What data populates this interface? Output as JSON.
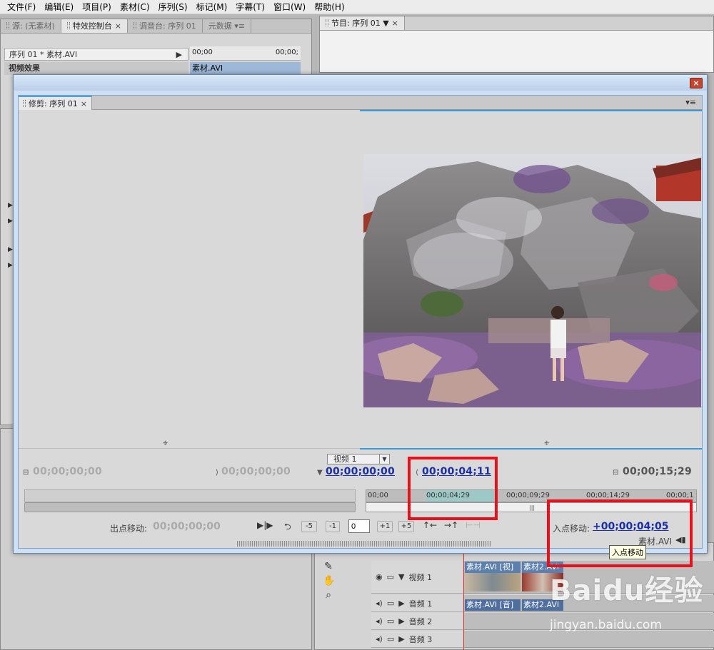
{
  "menubar": [
    "文件(F)",
    "编辑(E)",
    "项目(P)",
    "素材(C)",
    "序列(S)",
    "标记(M)",
    "字幕(T)",
    "窗口(W)",
    "帮助(H)"
  ],
  "left_panel": {
    "tabs": [
      "源: (无素材)",
      "特效控制台",
      "调音台: 序列 01",
      "元数据"
    ],
    "sequence_clip": "序列 01 * 素材.AVI",
    "ruler_start": "00;00",
    "ruler_end": "00;00;",
    "clip_label": "素材.AVI",
    "section": "视频效果"
  },
  "program_panel": {
    "tab": "节目: 序列 01"
  },
  "trim_window": {
    "tab": "修剪: 序列 01",
    "track_select": "视频 1",
    "timecodes": {
      "left_start": "00;00;00;00",
      "left_out": "00;00;00;00",
      "in_point": "00;00;00;00",
      "right_current": "00;00;04;11",
      "duration": "00;00;15;29"
    },
    "ruler_labels": [
      "00;00",
      "00;00;04;29",
      "00;00;09;29",
      "00;00;14;29",
      "00;00;1"
    ],
    "out_shift_label": "出点移动:",
    "out_shift_value": "00;00;00;00",
    "in_shift_label": "入点移动:",
    "in_shift_value": "+00;00;04;05",
    "buttons": {
      "minus5": "-5",
      "minus1": "-1",
      "plus1": "+1",
      "plus5": "+5"
    },
    "offset_value": "0",
    "clip_name": "素材.AVI"
  },
  "tooltip": "入点移动",
  "timeline": {
    "tracks": [
      "视频 1",
      "音频 1",
      "音频 2",
      "音频 3"
    ],
    "clips": {
      "video_a": "素材.AVI [视]",
      "video_b": "素材2.AVI",
      "audio_a": "素材.AVI [音]",
      "audio_b": "素材2.AVI"
    }
  },
  "watermark": {
    "brand": "Baidu经验",
    "url": "jingyan.baidu.com"
  }
}
